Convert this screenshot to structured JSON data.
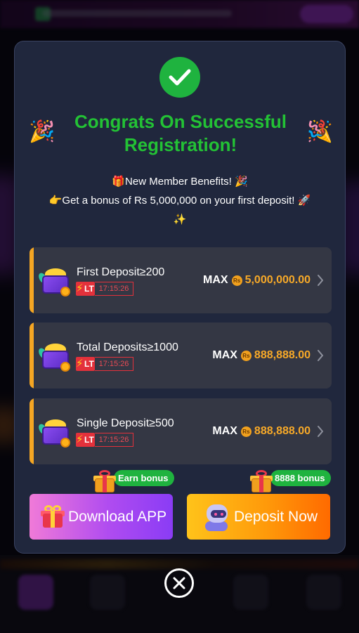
{
  "modal": {
    "title": "Congrats On Successful Registration!",
    "benefits_line1": "🎁New Member Benefits! 🎉",
    "benefits_line2": "👉Get a bonus of Rs 5,000,000 on your first deposit! 🚀",
    "benefits_line3": "✨"
  },
  "colors": {
    "title_green": "#23c235",
    "accent_orange": "#f7a928",
    "badge_red": "#e3313b",
    "tag_green": "#1fb33f"
  },
  "offers": [
    {
      "label": "First Deposit≥200",
      "lt": "LT",
      "timer": "17:15:26",
      "max_label": "MAX",
      "currency": "Rs",
      "amount": "5,000,000.00"
    },
    {
      "label": "Total Deposits≥1000",
      "lt": "LT",
      "timer": "17:15:26",
      "max_label": "MAX",
      "currency": "Rs",
      "amount": "888,888.00"
    },
    {
      "label": "Single Deposit≥500",
      "lt": "LT",
      "timer": "17:15:26",
      "max_label": "MAX",
      "currency": "Rs",
      "amount": "888,888.00"
    }
  ],
  "buttons": {
    "download_label": "Download APP",
    "download_tag": "Earn bonus",
    "deposit_label": "Deposit Now",
    "deposit_tag": "8888 bonus"
  },
  "icons": {
    "success": "check-icon",
    "party": "party-popper-icon",
    "offer": "treasure-chest-icon",
    "chevron": "chevron-right-icon",
    "download": "gift-icon",
    "deposit": "robot-icon",
    "close": "close-icon"
  }
}
